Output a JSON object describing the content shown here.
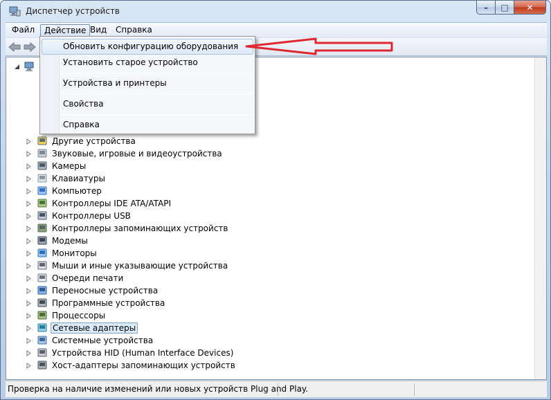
{
  "window": {
    "title": "Диспетчер устройств",
    "icon": "computer-manage-icon",
    "controls": {
      "minimize": "–",
      "maximize": "□",
      "close": "✕"
    }
  },
  "menubar": {
    "items": [
      {
        "label": "Файл"
      },
      {
        "label": "Действие",
        "active": true
      },
      {
        "label": "Вид"
      },
      {
        "label": "Справка"
      }
    ]
  },
  "toolbar": {
    "buttons": [
      "back-arrow-icon",
      "forward-arrow-icon"
    ]
  },
  "action_menu": {
    "items": [
      {
        "label": "Обновить конфигурацию оборудования",
        "highlighted": true
      },
      {
        "label": "Установить старое устройство"
      },
      {
        "label": "Устройства и принтеры"
      },
      {
        "label": "Свойства"
      },
      {
        "label": "Справка"
      }
    ]
  },
  "tree": {
    "root_icon": "computer-icon",
    "categories": [
      {
        "label": "Другие устройства",
        "icon": "unknown-device-icon"
      },
      {
        "label": "Звуковые, игровые и видеоустройства",
        "icon": "speaker-icon"
      },
      {
        "label": "Камеры",
        "icon": "webcam-icon"
      },
      {
        "label": "Клавиатуры",
        "icon": "keyboard-icon"
      },
      {
        "label": "Компьютер",
        "icon": "monitor-icon"
      },
      {
        "label": "Контроллеры IDE ATA/ATAPI",
        "icon": "ide-controller-icon"
      },
      {
        "label": "Контроллеры USB",
        "icon": "usb-icon"
      },
      {
        "label": "Контроллеры запоминающих устройств",
        "icon": "storage-controller-icon"
      },
      {
        "label": "Модемы",
        "icon": "modem-icon"
      },
      {
        "label": "Мониторы",
        "icon": "monitor-icon"
      },
      {
        "label": "Мыши и иные указывающие устройства",
        "icon": "mouse-icon"
      },
      {
        "label": "Очереди печати",
        "icon": "printer-icon"
      },
      {
        "label": "Переносные устройства",
        "icon": "portable-device-icon"
      },
      {
        "label": "Программные устройства",
        "icon": "software-device-icon"
      },
      {
        "label": "Процессоры",
        "icon": "processor-icon"
      },
      {
        "label": "Сетевые адаптеры",
        "icon": "network-adapter-icon",
        "selected": true
      },
      {
        "label": "Системные устройства",
        "icon": "system-device-icon"
      },
      {
        "label": "Устройства HID (Human Interface Devices)",
        "icon": "hid-icon"
      },
      {
        "label": "Хост-адаптеры запоминающих устройств",
        "icon": "storage-host-icon"
      }
    ]
  },
  "statusbar": {
    "text": "Проверка на наличие изменений или новых устройств Plug and Play."
  },
  "annotation": {
    "type": "red-arrow",
    "color": "#e0262f"
  }
}
